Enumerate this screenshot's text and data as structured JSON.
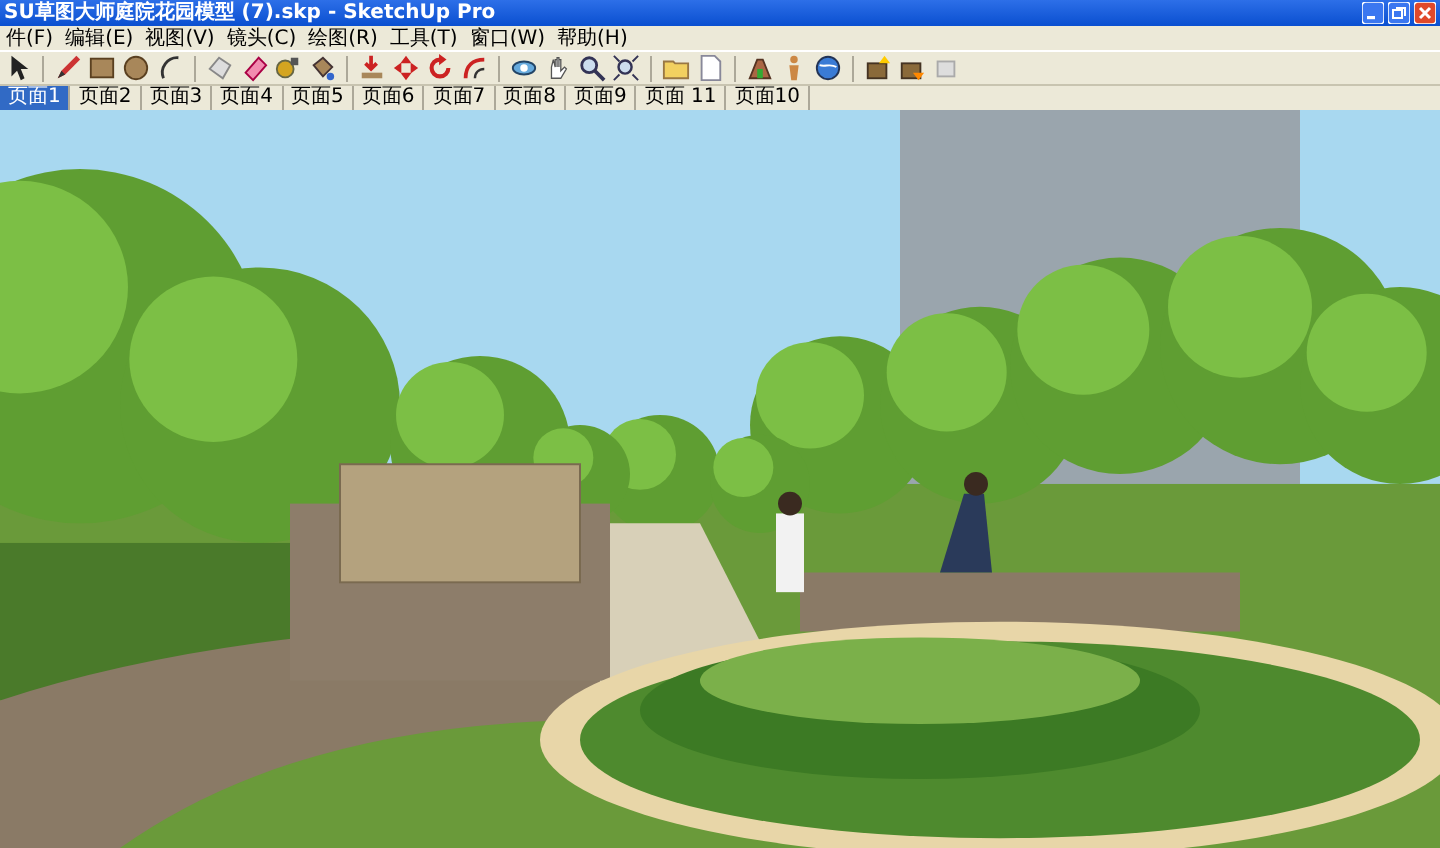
{
  "window": {
    "title": "SU草图大师庭院花园模型 (7).skp - SketchUp Pro"
  },
  "menu": {
    "items": [
      "件(F)",
      "编辑(E)",
      "视图(V)",
      "镜头(C)",
      "绘图(R)",
      "工具(T)",
      "窗口(W)",
      "帮助(H)"
    ]
  },
  "tabs": [
    {
      "label": "页面1",
      "selected": true
    },
    {
      "label": "页面2",
      "selected": false
    },
    {
      "label": "页面3",
      "selected": false
    },
    {
      "label": "页面4",
      "selected": false
    },
    {
      "label": "页面5",
      "selected": false
    },
    {
      "label": "页面6",
      "selected": false
    },
    {
      "label": "页面7",
      "selected": false
    },
    {
      "label": "页面8",
      "selected": false
    },
    {
      "label": "页面9",
      "selected": false
    },
    {
      "label": "页面 11",
      "selected": false
    },
    {
      "label": "页面10",
      "selected": false
    }
  ]
}
